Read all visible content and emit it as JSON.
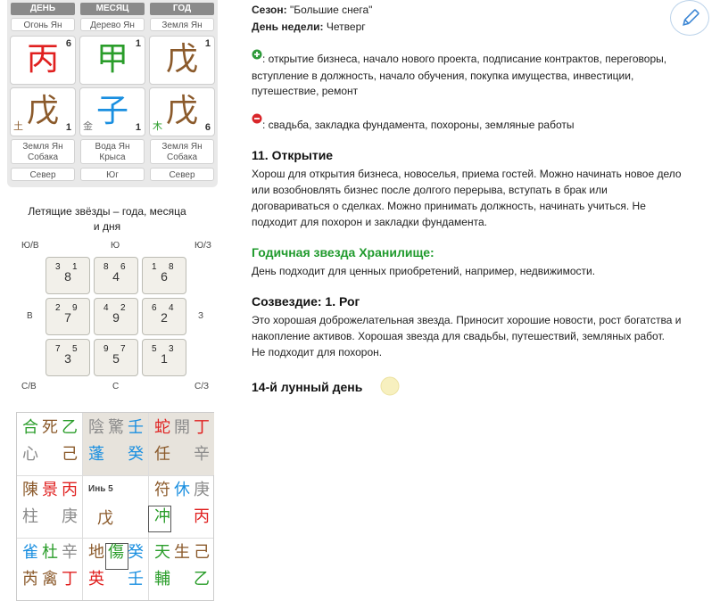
{
  "bazi": {
    "headers": [
      "ДЕНЬ",
      "МЕСЯЦ",
      "ГОД"
    ],
    "stem_labels": [
      "Огонь Ян",
      "Дерево Ян",
      "Земля Ян"
    ],
    "stems": [
      {
        "char": "丙",
        "num": "6",
        "color": "#e0201f"
      },
      {
        "char": "甲",
        "num": "1",
        "color": "#2a9d2a"
      },
      {
        "char": "戊",
        "num": "1",
        "color": "#8b5a2b"
      }
    ],
    "branches": [
      {
        "char": "戊",
        "elem": "土",
        "num": "1",
        "color": "#8b5a2b",
        "elem_color": "#8b5a2b"
      },
      {
        "char": "子",
        "elem": "金",
        "num": "1",
        "color": "#1a8fe0",
        "elem_color": "#777"
      },
      {
        "char": "戊",
        "elem": "木",
        "num": "6",
        "color": "#8b5a2b",
        "elem_color": "#2a9d2a"
      }
    ],
    "branch_labels": [
      {
        "l1": "Земля Ян",
        "l2": "Собака"
      },
      {
        "l1": "Вода Ян",
        "l2": "Крыса"
      },
      {
        "l1": "Земля Ян",
        "l2": "Собака"
      }
    ],
    "directions": [
      "Север",
      "Юг",
      "Север"
    ]
  },
  "flying_stars": {
    "title_line1": "Летящие звёзды – года, месяца",
    "title_line2": "и дня",
    "dirs": {
      "nw": "Ю/В",
      "n": "Ю",
      "ne": "Ю/З",
      "w": "В",
      "e": "З",
      "sw": "С/В",
      "s": "С",
      "se": "С/З"
    },
    "cells": [
      {
        "tl": "3",
        "tr": "1",
        "c": "8"
      },
      {
        "tl": "8",
        "tr": "6",
        "c": "4"
      },
      {
        "tl": "1",
        "tr": "8",
        "c": "6"
      },
      {
        "tl": "2",
        "tr": "9",
        "c": "7"
      },
      {
        "tl": "4",
        "tr": "2",
        "c": "9"
      },
      {
        "tl": "6",
        "tr": "4",
        "c": "2"
      },
      {
        "tl": "7",
        "tr": "5",
        "c": "3"
      },
      {
        "tl": "9",
        "tr": "7",
        "c": "5"
      },
      {
        "tl": "5",
        "tr": "3",
        "c": "1"
      }
    ]
  },
  "qimen": {
    "center_label": "Инь 5",
    "center_char": "戊",
    "palaces": [
      {
        "r1": [
          [
            "合",
            "#2a9d2a"
          ],
          [
            "死",
            "#8b5a2b"
          ],
          [
            "乙",
            "#2a9d2a"
          ]
        ],
        "r2": [
          [
            "心",
            "#8b8b8b"
          ],
          [
            "",
            ""
          ],
          [
            "己",
            "#8b5a2b"
          ]
        ]
      },
      {
        "r1": [
          [
            "陰",
            "#8b8b8b"
          ],
          [
            "驚",
            "#8b8b8b"
          ],
          [
            "壬",
            "#1a8fe0"
          ]
        ],
        "r2": [
          [
            "蓬",
            "#1a8fe0"
          ],
          [
            "",
            ""
          ],
          [
            "癸",
            "#1a8fe0"
          ]
        ]
      },
      {
        "r1": [
          [
            "蛇",
            "#e0201f"
          ],
          [
            "開",
            "#8b8b8b"
          ],
          [
            "丁",
            "#e0201f"
          ]
        ],
        "r2": [
          [
            "任",
            "#8b5a2b"
          ],
          [
            "",
            ""
          ],
          [
            "辛",
            "#8b8b8b"
          ]
        ]
      },
      {
        "r1": [
          [
            "陳",
            "#8b5a2b"
          ],
          [
            "景",
            "#e0201f"
          ],
          [
            "丙",
            "#e0201f"
          ]
        ],
        "r2": [
          [
            "柱",
            "#8b8b8b"
          ],
          [
            "",
            ""
          ],
          [
            "庚",
            "#8b8b8b"
          ]
        ]
      },
      {
        "r1": [
          [
            "符",
            "#8b5a2b"
          ],
          [
            "休",
            "#1a8fe0"
          ],
          [
            "庚",
            "#8b8b8b"
          ]
        ],
        "r2": [
          [
            "冲",
            "#2a9d2a"
          ],
          [
            "",
            ""
          ],
          [
            "丙",
            "#e0201f"
          ]
        ]
      },
      {
        "r1": [
          [
            "雀",
            "#1a8fe0"
          ],
          [
            "杜",
            "#2a9d2a"
          ],
          [
            "辛",
            "#8b8b8b"
          ]
        ],
        "r2": [
          [
            "芮",
            "#8b5a2b"
          ],
          [
            "禽",
            "#8b5a2b"
          ],
          [
            "丁",
            "#e0201f"
          ]
        ]
      },
      {
        "r1": [
          [
            "地",
            "#8b5a2b"
          ],
          [
            "傷",
            "#2a9d2a"
          ],
          [
            "癸",
            "#1a8fe0"
          ]
        ],
        "r2": [
          [
            "英",
            "#e0201f"
          ],
          [
            "",
            ""
          ],
          [
            "壬",
            "#1a8fe0"
          ]
        ]
      },
      {
        "r1": [
          [
            "天",
            "#2a9d2a"
          ],
          [
            "生",
            "#8b5a2b"
          ],
          [
            "己",
            "#8b5a2b"
          ]
        ],
        "r2": [
          [
            "輔",
            "#2a9d2a"
          ],
          [
            "",
            ""
          ],
          [
            "乙",
            "#2a9d2a"
          ]
        ]
      }
    ]
  },
  "info": {
    "season_label": "Сезон:",
    "season_value": "\"Большие снега\"",
    "weekday_label": "День недели:",
    "weekday_value": "Четверг",
    "good_line1": ": открытие бизнеса, начало нового проекта, подписание контрактов, переговоры,",
    "good_line2": "вступление в должность, начало обучения, покупка имущества, инвестиции,",
    "good_line3": "путешествие, ремонт",
    "bad_line": ": свадьба, закладка фундамента, похороны, земляные работы",
    "officer_title": "11. Открытие",
    "officer_l1": "Хорош для открытия бизнеса, новоселья, приема гостей. Можно начинать новое дело",
    "officer_l2": "или возобновлять бизнес после долгого перерыва, вступать в брак или",
    "officer_l3": "договариваться о сделках. Можно принимать должность, начинать учиться. Не",
    "officer_l4": "подходит для похорон и закладки фундамента.",
    "annual_title": "Годичная звезда Хранилище:",
    "annual_text": "День подходит для ценных приобретений, например, недвижимости.",
    "constellation_title": "Созвездие: 1. Рог",
    "const_l1": "Это хорошая доброжелательная звезда. Приносит хорошие новости, рост богатства и",
    "const_l2": "накопление активов. Хорошая звезда для свадьбы, путешествий, земляных работ.",
    "const_l3": "Не подходит для похорон.",
    "lunar_day": "14-й лунный день"
  },
  "colors": {
    "green": "#2a9d2a",
    "red": "#e0201f",
    "blue": "#1a8fe0",
    "brown": "#8b5a2b",
    "grey": "#8b8b8b"
  }
}
